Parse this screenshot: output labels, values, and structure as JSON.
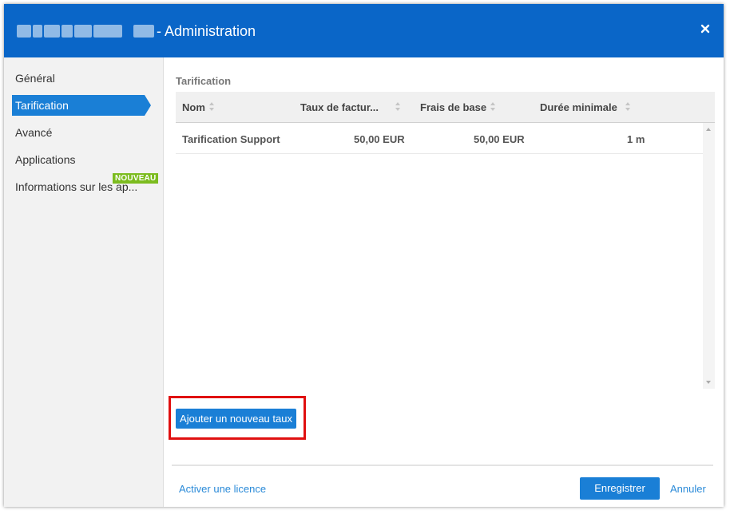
{
  "window": {
    "title": "- Administration",
    "colors": {
      "titlebar": "#0a66c8",
      "accent": "#1a7fd6",
      "badge": "#7cbc1f",
      "highlight": "#e01010",
      "link": "#2a8ad8"
    }
  },
  "sidebar": {
    "items": [
      {
        "label": "Général"
      },
      {
        "label": "Tarification",
        "active": true
      },
      {
        "label": "Avancé"
      },
      {
        "label": "Applications"
      },
      {
        "label": "Informations sur les ap...",
        "badge": "NOUVEAU"
      }
    ]
  },
  "main": {
    "section_title": "Tarification",
    "table": {
      "columns": [
        "Nom",
        "Taux de factur...",
        "Frais de base",
        "Durée minimale"
      ],
      "rows": [
        [
          "Tarification Support",
          "50,00 EUR",
          "50,00 EUR",
          "1 m"
        ]
      ]
    },
    "add_rate_button": "Ajouter un nouveau taux"
  },
  "footer": {
    "license_link": "Activer une licence",
    "save_button": "Enregistrer",
    "cancel_link": "Annuler"
  }
}
